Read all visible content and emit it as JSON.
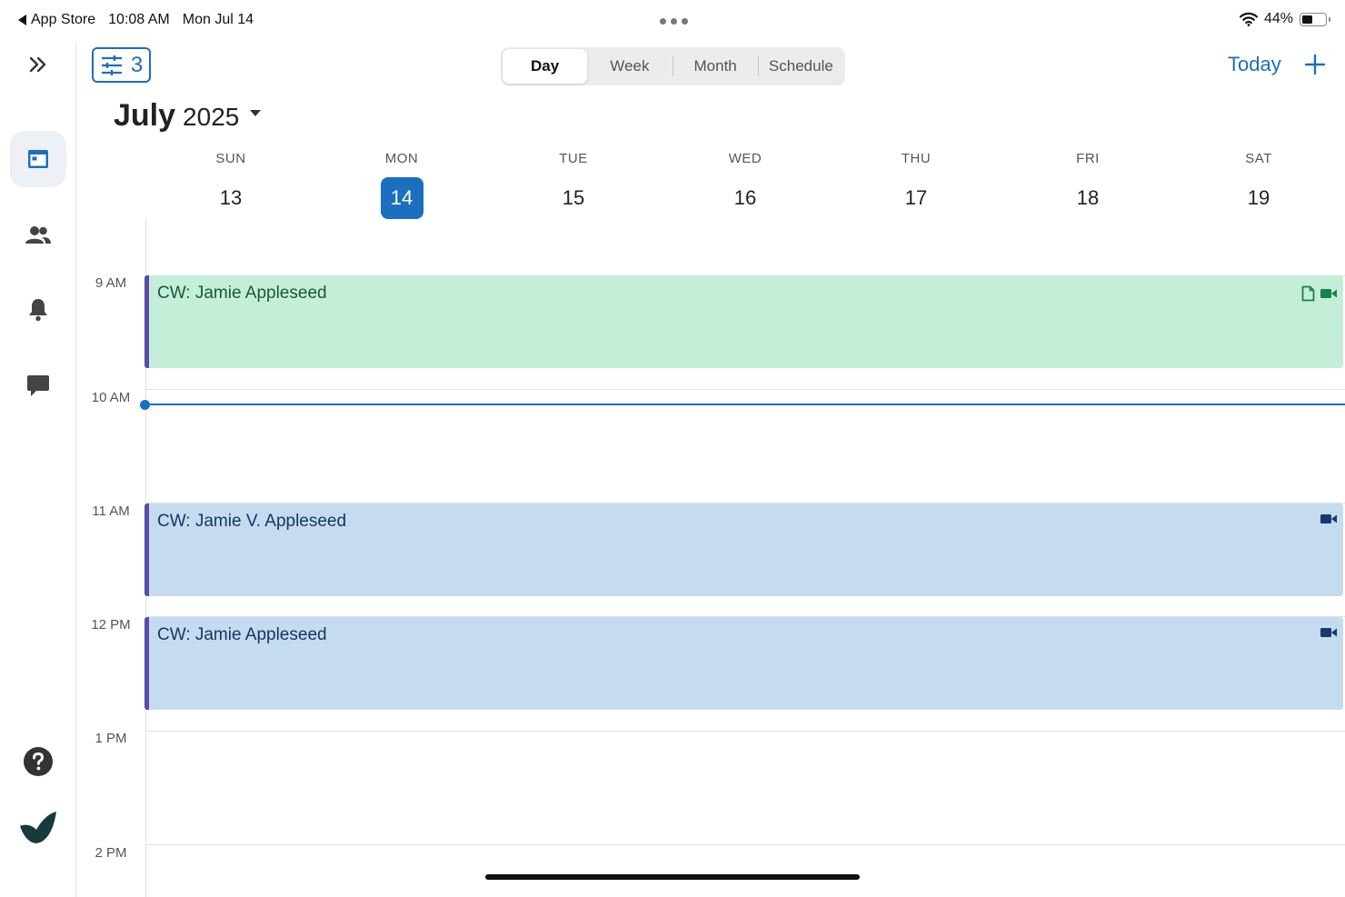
{
  "status_bar": {
    "back_label": "App Store",
    "time": "10:08 AM",
    "date": "Mon Jul 14",
    "battery_percent": "44%",
    "battery_level": 0.44
  },
  "sidebar": {
    "items": [
      {
        "icon": "chevrons-right-icon"
      },
      {
        "icon": "calendar-icon",
        "active": true
      },
      {
        "icon": "people-icon"
      },
      {
        "icon": "bell-icon"
      },
      {
        "icon": "chat-icon"
      },
      {
        "icon": "help-icon"
      },
      {
        "icon": "app-logo-icon"
      }
    ]
  },
  "toolbar": {
    "filter_count": "3",
    "views": [
      "Day",
      "Week",
      "Month",
      "Schedule"
    ],
    "active_view": "Day",
    "today_label": "Today"
  },
  "calendar": {
    "month": "July",
    "year": "2025",
    "days": [
      {
        "name": "SUN",
        "date": "13"
      },
      {
        "name": "MON",
        "date": "14",
        "today": true
      },
      {
        "name": "TUE",
        "date": "15"
      },
      {
        "name": "WED",
        "date": "16"
      },
      {
        "name": "THU",
        "date": "17"
      },
      {
        "name": "FRI",
        "date": "18"
      },
      {
        "name": "SAT",
        "date": "19"
      }
    ],
    "time_labels": [
      "9 AM",
      "10 AM",
      "11 AM",
      "12 PM",
      "1 PM",
      "2 PM"
    ],
    "events": [
      {
        "title": "CW: Jamie Appleseed",
        "start": "9 AM",
        "icons": [
          "document-icon",
          "video-icon"
        ],
        "color": "#c5eed9"
      },
      {
        "title": "CW: Jamie V. Appleseed",
        "start": "11 AM",
        "icons": [
          "video-icon"
        ],
        "color": "#c5dbf0"
      },
      {
        "title": "CW: Jamie Appleseed",
        "start": "12 PM",
        "icons": [
          "video-icon"
        ],
        "color": "#c5dbf0"
      }
    ]
  },
  "colors": {
    "accent": "#1a6fbf",
    "event_border": "#5b4aa8"
  }
}
